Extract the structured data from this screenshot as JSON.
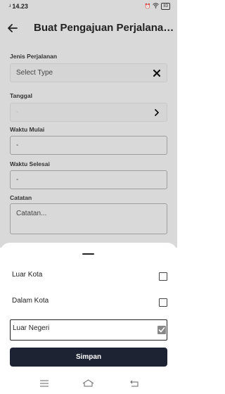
{
  "status_bar": {
    "signal": "..ıl",
    "time": "14.23",
    "battery": "83"
  },
  "header": {
    "title": "Buat Pengajuan Perjalana…"
  },
  "form": {
    "jenis": {
      "label": "Jenis Perjalanan",
      "value": "Select Type"
    },
    "tanggal": {
      "label": "Tanggal",
      "value": "-"
    },
    "waktu_mulai": {
      "label": "Waktu Mulai",
      "value": "-"
    },
    "waktu_selesai": {
      "label": "Waktu Selesai",
      "value": "-"
    },
    "catatan": {
      "label": "Catatan",
      "placeholder": "Catatan..."
    }
  },
  "sheet": {
    "options": [
      {
        "label": "Luar Kota",
        "checked": false
      },
      {
        "label": "Dalam Kota",
        "checked": false
      },
      {
        "label": "Luar Negeri",
        "checked": true
      }
    ],
    "save_label": "Simpan"
  },
  "nav": {
    "icons": [
      "menu-icon",
      "home-icon",
      "back-nav-icon"
    ]
  },
  "colors": {
    "overlay": "#d9d9d9",
    "button": "#1d2333",
    "sheet": "#ffffff"
  }
}
